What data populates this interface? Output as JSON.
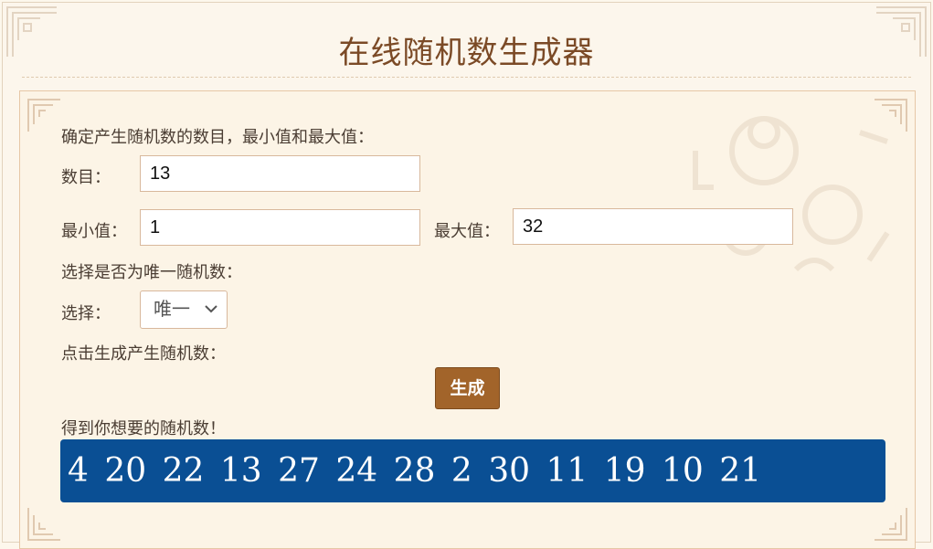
{
  "header": {
    "title": "在线随机数生成器"
  },
  "form": {
    "instruction": "确定产生随机数的数目，最小值和最大值：",
    "count_label": "数目：",
    "count_value": "13",
    "min_label": "最小值：",
    "min_value": "1",
    "max_label": "最大值：",
    "max_value": "32",
    "unique_prompt": "选择是否为唯一随机数：",
    "select_label": "选择：",
    "select_value": "唯一",
    "generate_prompt": "点击生成产生随机数：",
    "generate_button": "生成",
    "result_label": "得到你想要的随机数！",
    "result_numbers": "4 20 22 13 27 24 28 2 30 11 19 10 21"
  },
  "colors": {
    "title": "#7b4a26",
    "button": "#a2642a",
    "result_bg": "#0a4f94",
    "background": "#fdf7ec"
  },
  "icons": {
    "corner": "ornament-corner-icon",
    "dropdown": "chevron-down-icon",
    "watermark": "numbers-watermark"
  }
}
